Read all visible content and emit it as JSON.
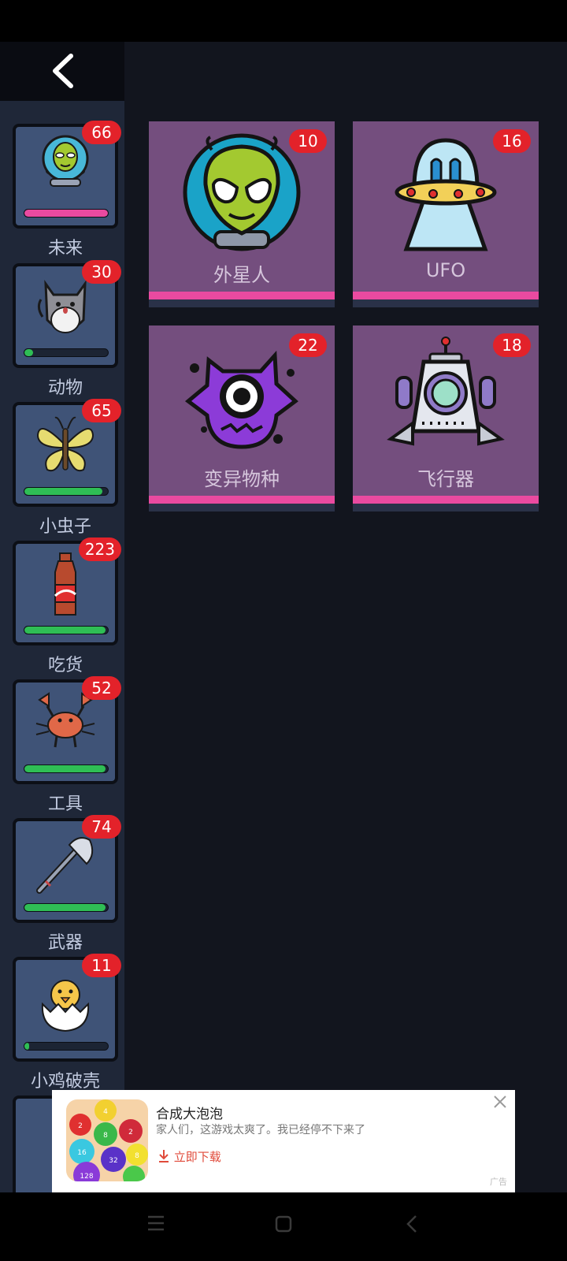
{
  "categories": [
    {
      "name": "未来",
      "count": "66",
      "progress": 1.0,
      "icon": "alien-globe-icon"
    },
    {
      "name": "动物",
      "count": "30",
      "progress": 0.1,
      "icon": "cat-icon"
    },
    {
      "name": "小虫子",
      "count": "65",
      "progress": 0.93,
      "icon": "butterfly-icon"
    },
    {
      "name": "吃货",
      "count": "223",
      "progress": 0.97,
      "icon": "soda-bottle-icon"
    },
    {
      "name": "工具",
      "count": "52",
      "progress": 0.97,
      "icon": "crab-icon"
    },
    {
      "name": "武器",
      "count": "74",
      "progress": 0.97,
      "icon": "axe-icon"
    },
    {
      "name": "小鸡破壳",
      "count": "11",
      "progress": 0.06,
      "icon": "chick-egg-icon"
    }
  ],
  "items": [
    {
      "name": "外星人",
      "count": "10",
      "icon": "alien-icon"
    },
    {
      "name": "UFO",
      "count": "16",
      "icon": "ufo-icon"
    },
    {
      "name": "变异物种",
      "count": "22",
      "icon": "mutant-monster-icon"
    },
    {
      "name": "飞行器",
      "count": "18",
      "icon": "spaceship-icon"
    }
  ],
  "ad": {
    "title": "合成大泡泡",
    "description": "家人们，这游戏太爽了。我已经停不下来了",
    "download_label": "立即下载",
    "tag": "广告",
    "ball_numbers": [
      "4",
      "2",
      "8",
      "2",
      "16",
      "32",
      "8",
      "128"
    ]
  },
  "colors": {
    "accent": "#ea4aa0",
    "badge": "#e3222a",
    "card": "#744e7e",
    "progress": "#2fbe55"
  }
}
